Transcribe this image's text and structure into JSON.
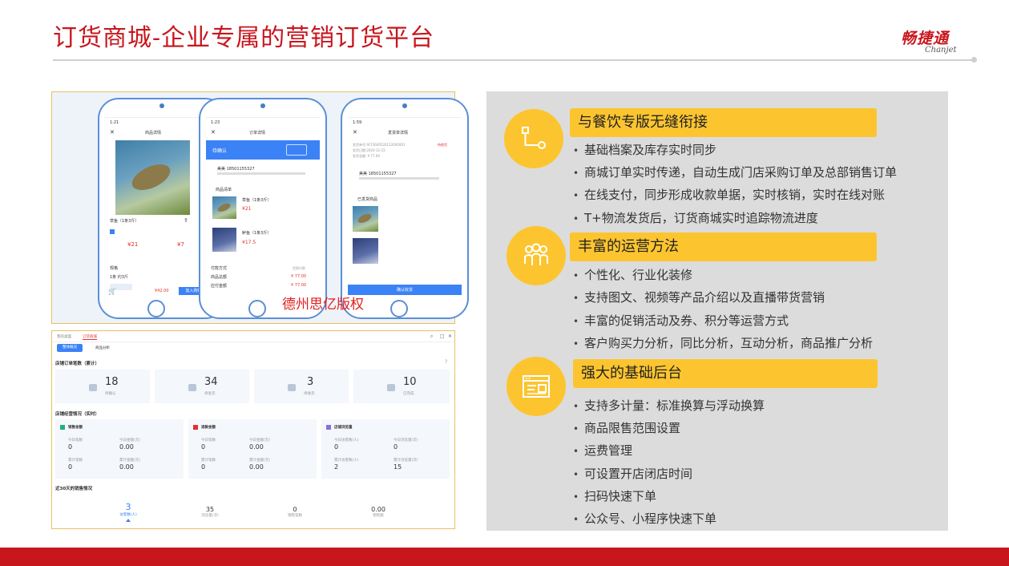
{
  "slide": {
    "title": "订货商城-企业专属的营销订货平台",
    "logo_cn": "畅捷通",
    "logo_en": "Chanjet",
    "watermark": "德州思亿版权"
  },
  "phones": {
    "p1": {
      "time": "1:21",
      "title": "商品详情",
      "product": "草鱼（1条3斤）",
      "price_a": "¥21",
      "price_b": "¥7",
      "spec_label": "规格",
      "spec_value": "1条 约3斤",
      "cart_price": "¥42.00",
      "add_cart": "加入购物车"
    },
    "p2": {
      "time": "1:23",
      "title": "订单详情",
      "status": "待确认",
      "contact": "美美 18501155327",
      "list_label": "商品清单",
      "item1_name": "草鱼（1条3斤）",
      "item1_price": "¥21",
      "item2_name": "鲈鱼（1条3斤）",
      "item2_price": "¥17.5",
      "pay_label": "付款方式",
      "pay_value": "货到付款",
      "total_label": "商品总额",
      "total_value": "¥ 77.00",
      "due_label": "应付金额",
      "due_value": "¥ 77.00"
    },
    "p3": {
      "time": "1:59",
      "title": "发货单详情",
      "status": "待收货",
      "order_no": "发货单号:SF15600520122000001",
      "date": "发货日期:2020-12-23",
      "amount": "发货金额: ¥ 77.00",
      "contact": "美美 18501155327",
      "list_label": "已发货商品",
      "confirm": "确认收货"
    }
  },
  "dashboard": {
    "tab1": "我的桌面",
    "tab2": "订货商城",
    "sub1": "整体概况",
    "sub2": "商品分析",
    "section1": "店铺订单笔数（累计）",
    "counts": [
      {
        "value": "18",
        "label": "待确认"
      },
      {
        "value": "34",
        "label": "待发货"
      },
      {
        "value": "3",
        "label": "待收货"
      },
      {
        "value": "10",
        "label": "已完成"
      }
    ],
    "section2": "店铺经营情况（实时）",
    "cards": [
      {
        "title": "销售金额",
        "l1": "今日笔数",
        "v1": "0",
        "l2": "今日金额(元)",
        "v2": "0.00",
        "l3": "累计笔数",
        "v3": "0",
        "l4": "累计金额(元)",
        "v4": "0.00"
      },
      {
        "title": "退款金额",
        "l1": "今日笔数",
        "v1": "0",
        "l2": "今日金额(元)",
        "v2": "0.00",
        "l3": "累计笔数",
        "v3": "0",
        "l4": "累计金额(元)",
        "v4": "0.00"
      },
      {
        "title": "店铺浏览量",
        "l1": "今日访客数(人)",
        "v1": "0",
        "l2": "今日浏览量(次)",
        "v2": "0",
        "l3": "累计访客数(人)",
        "v3": "2",
        "l4": "累计浏览量(次)",
        "v4": "15"
      }
    ],
    "section3": "近30天的销售情况",
    "stats": [
      {
        "value": "3",
        "label": "访客数(人)"
      },
      {
        "value": "35",
        "label": "浏览量(次)"
      },
      {
        "value": "0",
        "label": "销售笔数"
      },
      {
        "value": "0.00",
        "label": "销售额"
      }
    ]
  },
  "features": [
    {
      "icon": "flow-icon",
      "title": "与餐饮专版无缝衔接",
      "items": [
        "基础档案及库存实时同步",
        "商城订单实时传递，自动生成门店采购订单及总部销售订单",
        "在线支付，同步形成收款单据，实时核销，实时在线对账",
        "T+物流发货后，订货商城实时追踪物流进度"
      ]
    },
    {
      "icon": "team-icon",
      "title": "丰富的运营方法",
      "items": [
        "个性化、行业化装修",
        "支持图文、视频等产品介绍以及直播带货营销",
        "丰富的促销活动及券、积分等运营方式",
        "客户购买力分析，同比分析，互动分析，商品推广分析"
      ]
    },
    {
      "icon": "browser-window-icon",
      "title": "强大的基础后台",
      "items": [
        "支持多计量：标准换算与浮动换算",
        "商品限售范围设置",
        "运费管理",
        "可设置开店闭店时间",
        "扫码快速下单",
        "公众号、小程序快速下单"
      ]
    }
  ],
  "colors": {
    "accent_red": "#c8161d",
    "feature_yellow": "#fcc52f",
    "phone_blue": "#3b82f6"
  }
}
